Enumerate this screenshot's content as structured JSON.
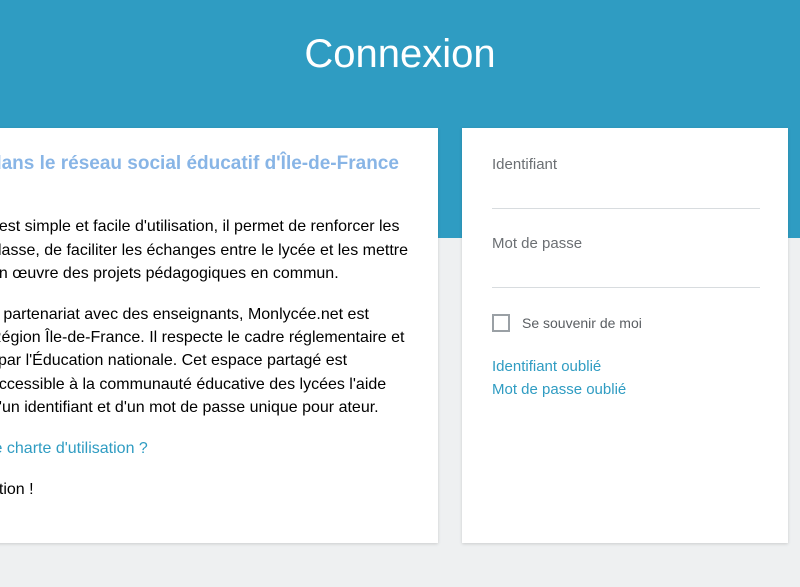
{
  "header": {
    "title": "Connexion"
  },
  "info": {
    "title": " dans le réseau social éducatif d'Île-de-France !",
    "para1": "t est simple et facile d'utilisation, il permet de renforcer les classe, de faciliter les échanges entre le lycée et les mettre en œuvre des projets pédagogiques en commun.",
    "para2": "n partenariat avec des enseignants, Monlycée.net est Région Île-de-France. Il respecte le cadre réglementaire et i par l'Éducation nationale. Cet espace partagé est accessible à la communauté éducative des lycées l'aide d'un identifiant et d'un mot de passe unique pour ateur.",
    "charter_link": "le charte d'utilisation ?",
    "footer_text": "ation !"
  },
  "login": {
    "username_label": "Identifiant",
    "password_label": "Mot de passe",
    "remember_label": "Se souvenir de moi",
    "forgot_username": "Identifiant oublié",
    "forgot_password": "Mot de passe oublié"
  }
}
